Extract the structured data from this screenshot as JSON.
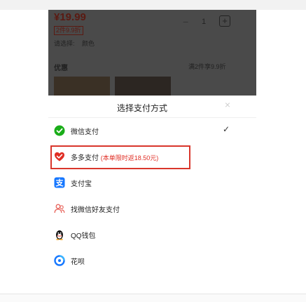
{
  "product": {
    "price": "¥19.99",
    "unit_price": "2件9.9折",
    "quantity": "1",
    "minus": "−",
    "plus": "+",
    "select_label": "请选择:",
    "select_value": "颜色",
    "promo_label": "优惠",
    "promo_text": "满2件享9.9折"
  },
  "sheet": {
    "title": "选择支付方式",
    "close": "×",
    "check": "✓",
    "options": [
      {
        "label": "微信支付",
        "icon": "wechat-pay-icon",
        "selected": true
      },
      {
        "label": "多多支付",
        "promo": "(本单限时返18.50元)",
        "icon": "duoduo-pay-icon",
        "highlighted": true
      },
      {
        "label": "支付宝",
        "icon": "alipay-icon"
      },
      {
        "label": "找微信好友支付",
        "icon": "wechat-friend-pay-icon"
      },
      {
        "label": "QQ钱包",
        "icon": "qq-wallet-icon"
      },
      {
        "label": "花呗",
        "icon": "huabei-icon"
      }
    ]
  },
  "colors": {
    "wechat_green": "#1aad19",
    "duoduo_red": "#e02e24",
    "alipay_blue": "#1677ff",
    "highlight_border": "#d9362c"
  }
}
